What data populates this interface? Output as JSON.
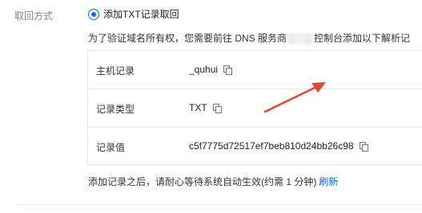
{
  "field": {
    "label": "取回方式"
  },
  "method": {
    "selected_label": "添加TXT记录取回"
  },
  "hint": {
    "before": "为了验证域名所有权，您需要前往 DNS 服务商",
    "after": "控制台添加以下解析记"
  },
  "records": [
    {
      "key": "主机记录",
      "value": "_quhui"
    },
    {
      "key": "记录类型",
      "value": "TXT"
    },
    {
      "key": "记录值",
      "value": "c5f7775d72517ef7beb810d24bb26c98"
    }
  ],
  "footer": {
    "text": "添加记录之后，请耐心等待系统自动生效(约需 1 分钟)",
    "refresh_label": "刷新"
  },
  "colors": {
    "accent": "#006eff",
    "annotation_arrow": "#e0492c"
  },
  "icons": {
    "copy": "copy-icon",
    "radio": "radio-checked-icon"
  }
}
